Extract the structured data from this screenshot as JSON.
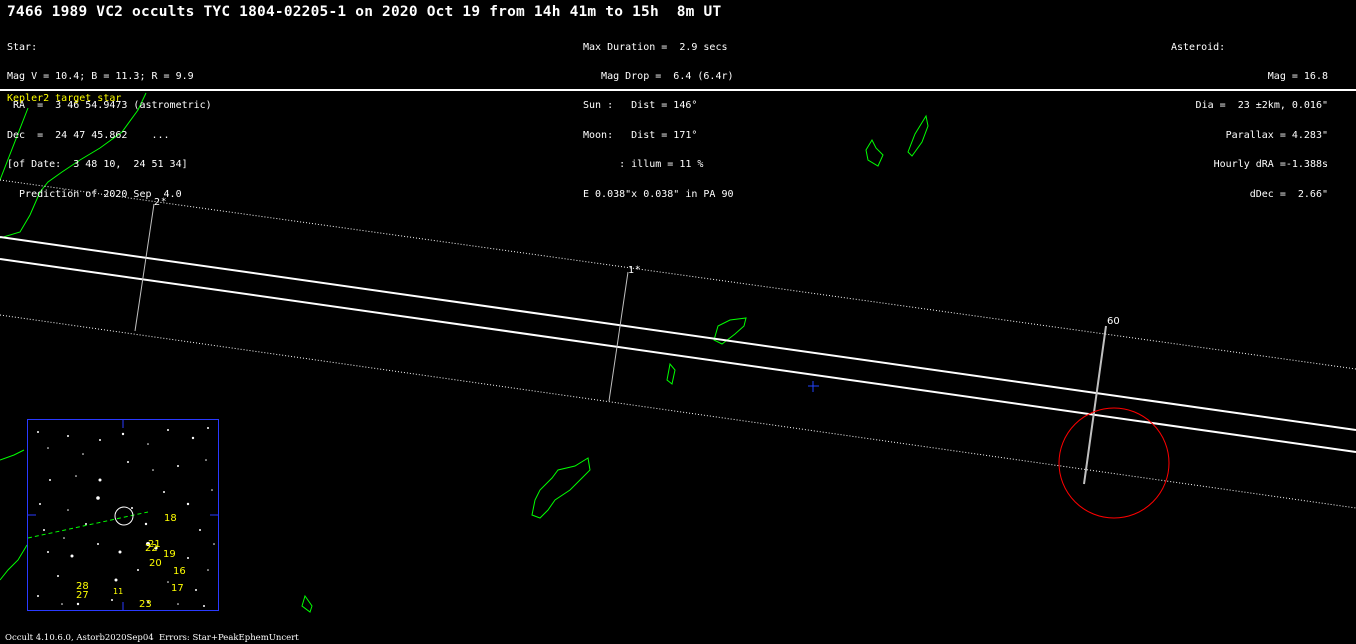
{
  "title": "7466 1989 VC2 occults TYC 1804-02205-1 on 2020 Oct 19 from 14h 41m to 15h  8m UT",
  "star_block": [
    "Star:",
    "Mag V = 10.4; B = 11.3; R = 9.9",
    " RA  =  3 46 54.9473 (astrometric)",
    "Dec  =  24 47 45.862    ...",
    "[of Date:  3 48 10,  24 51 34]",
    "  Prediction of 2020 Sep  4.0"
  ],
  "event_block": [
    "Max Duration =  2.9 secs",
    "   Mag Drop =  6.4 (6.4r)",
    "Sun :   Dist = 146°",
    "Moon:   Dist = 171°",
    "      : illum = 11 %",
    "E 0.038\"x 0.038\" in PA 90"
  ],
  "asteroid_block": [
    "Asteroid:",
    "Mag = 16.8",
    "Dia =  23 ±2km, 0.016\"",
    "Parallax = 4.283\"",
    "Hourly dRA =-1.388s",
    "dDec =  2.66\""
  ],
  "kepler_label": "Kepler2 target star",
  "footer": "Occult 4.10.6.0, Astorb2020Sep04  Errors: Star+PeakEphemUncert",
  "path_labels": {
    "sigma2": "2",
    "sigma1": "1",
    "error_60": "60"
  },
  "inset_star_numbers": [
    "18",
    "21",
    "22",
    "19",
    "20",
    "16",
    "28",
    "27",
    "17",
    "23",
    "11"
  ],
  "colors": {
    "background": "#000000",
    "text": "#ffffff",
    "coastline": "#00ff00",
    "kepler_label": "#ffff00",
    "error_ellipse": "#ff0000",
    "center_cross": "#2244ff",
    "inset_border": "#2a3aff"
  }
}
